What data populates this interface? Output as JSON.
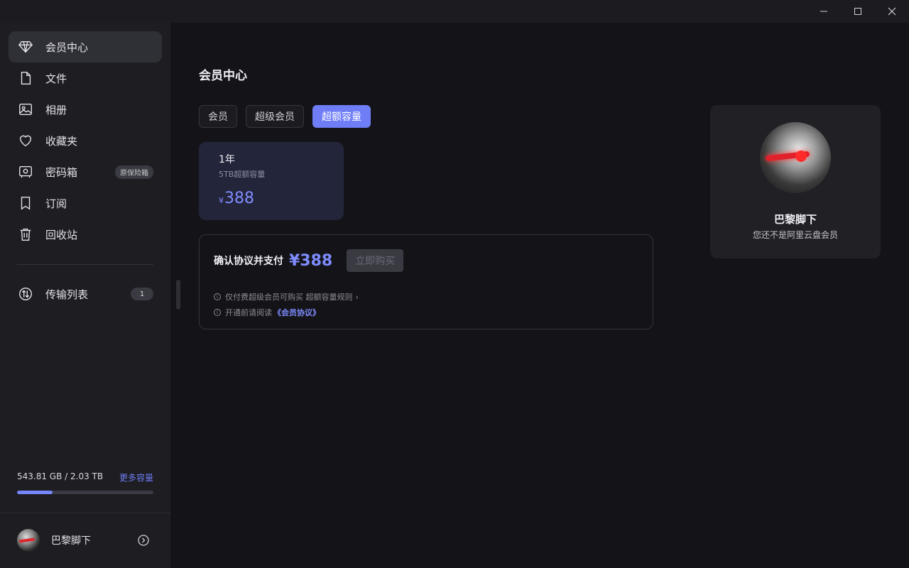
{
  "window": {
    "controls": [
      "minimize",
      "maximize",
      "close"
    ]
  },
  "sidebar": {
    "items": [
      {
        "label": "会员中心",
        "icon": "diamond-icon",
        "active": true
      },
      {
        "label": "文件",
        "icon": "file-icon"
      },
      {
        "label": "相册",
        "icon": "image-icon"
      },
      {
        "label": "收藏夹",
        "icon": "heart-icon"
      },
      {
        "label": "密码箱",
        "icon": "safe-icon",
        "tag": "原保险箱"
      },
      {
        "label": "订阅",
        "icon": "bookmark-icon"
      },
      {
        "label": "回收站",
        "icon": "trash-icon"
      }
    ],
    "transfer": {
      "label": "传输列表",
      "icon": "transfer-icon",
      "count": "1"
    },
    "storage": {
      "usage_text": "543.81 GB / 2.03 TB",
      "more_label": "更多容量",
      "used_fraction": 0.26
    },
    "user": {
      "name": "巴黎脚下",
      "icon": "settings-icon"
    }
  },
  "main": {
    "title": "会员中心",
    "tabs": [
      {
        "label": "会员",
        "active": false
      },
      {
        "label": "超级会员",
        "active": false
      },
      {
        "label": "超额容量",
        "active": true
      }
    ],
    "plan": {
      "duration": "1年",
      "desc": "5TB超额容量",
      "currency": "¥",
      "price": "388"
    },
    "payment": {
      "label": "确认协议并支付",
      "price": "¥388",
      "buy_label": "立即购买",
      "notes": [
        {
          "text": "仅付费超级会员可购买 超额容量规则",
          "link": "",
          "chevron": true
        },
        {
          "text": "开通前请阅读",
          "link": "《会员协议》",
          "chevron": false
        }
      ]
    }
  },
  "profile": {
    "name": "巴黎脚下",
    "status": "您还不是阿里云盘会员"
  },
  "colors": {
    "accent": "#6f7df7",
    "price": "#7f8cff",
    "background": "#141418",
    "sidebar": "#1d1d22"
  }
}
